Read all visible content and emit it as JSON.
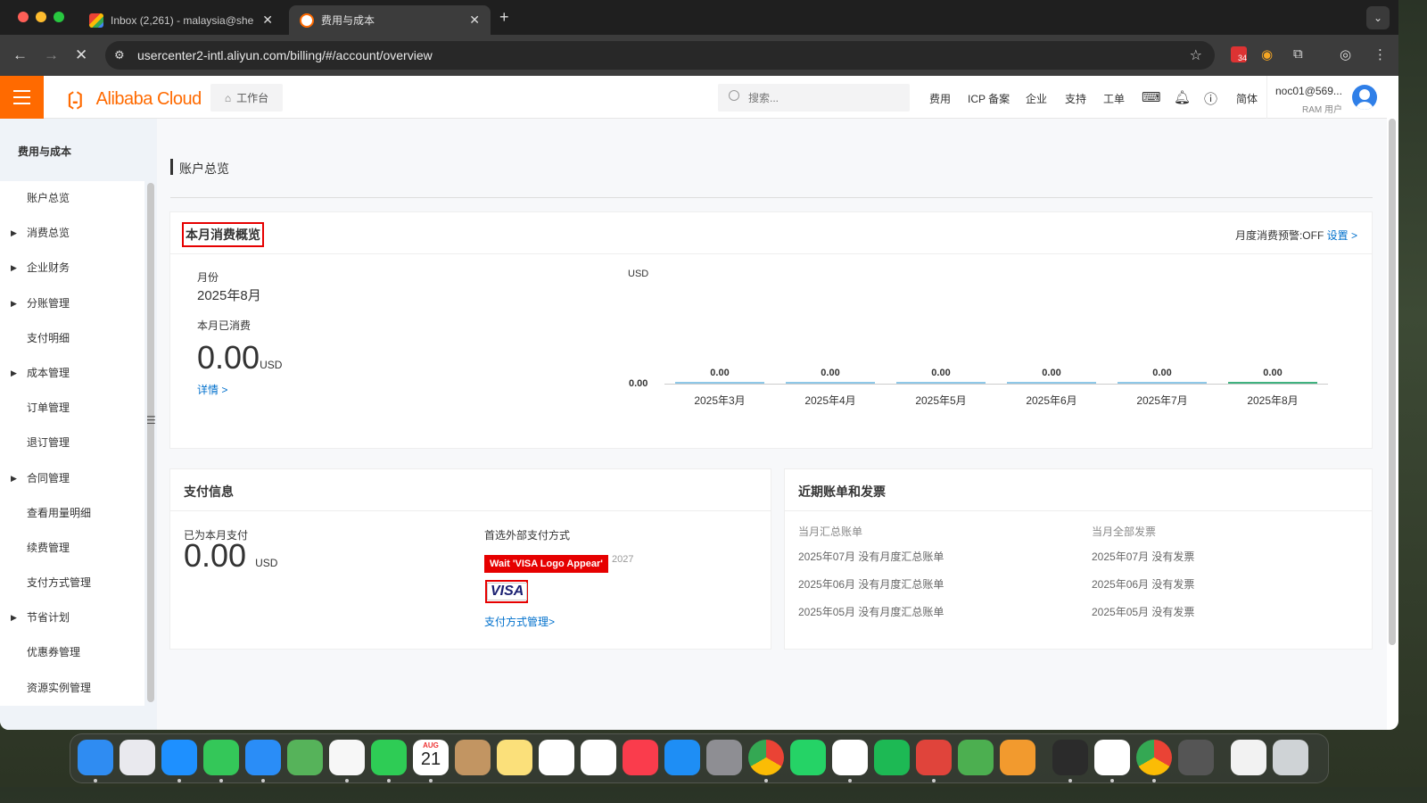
{
  "browser": {
    "tabs": [
      {
        "title": "Inbox (2,261) - malaysia@she",
        "favicon_color": "#ea4335"
      },
      {
        "title": "费用与成本",
        "favicon_color": "#ff6a00"
      }
    ],
    "url": "usercenter2-intl.aliyun.com/billing/#/account/overview",
    "calendar_badge": "34"
  },
  "header": {
    "logo_mark": "〔-〕",
    "logo_text": "Alibaba Cloud",
    "workbench": "工作台",
    "search_placeholder": "搜索...",
    "nav": [
      "费用",
      "ICP 备案",
      "企业",
      "支持",
      "工单"
    ],
    "lang": "简体",
    "user_name": "noc01@569...",
    "user_role": "RAM 用户"
  },
  "sidebar": {
    "title": "费用与成本",
    "items": [
      {
        "label": "账户总览",
        "expandable": false
      },
      {
        "label": "消费总览",
        "expandable": true
      },
      {
        "label": "企业财务",
        "expandable": true
      },
      {
        "label": "分账管理",
        "expandable": true
      },
      {
        "label": "支付明细",
        "expandable": false
      },
      {
        "label": "成本管理",
        "expandable": true
      },
      {
        "label": "订单管理",
        "expandable": false
      },
      {
        "label": "退订管理",
        "expandable": false
      },
      {
        "label": "合同管理",
        "expandable": true
      },
      {
        "label": "查看用量明细",
        "expandable": false
      },
      {
        "label": "续费管理",
        "expandable": false
      },
      {
        "label": "支付方式管理",
        "expandable": false
      },
      {
        "label": "节省计划",
        "expandable": true
      },
      {
        "label": "优惠券管理",
        "expandable": false
      },
      {
        "label": "资源实例管理",
        "expandable": false
      }
    ]
  },
  "page": {
    "title": "账户总览",
    "overview": {
      "title": "本月消费概览",
      "alert_label": "月度消费预警:OFF",
      "alert_link": "设置 >",
      "month_label": "月份",
      "month_value": "2025年8月",
      "spent_label": "本月已消费",
      "spent_amount": "0.00",
      "spent_unit": "USD",
      "details_link": "详情 >"
    },
    "payment": {
      "title": "支付信息",
      "paid_label": "已为本月支付",
      "paid_amount": "0.00",
      "paid_unit": "USD",
      "method_label": "首选外部支付方式",
      "warn_tag": "Wait 'VISA Logo Appear'",
      "ghost_date": "2027",
      "card_brand": "VISA",
      "manage_link": "支付方式管理>"
    },
    "bills": {
      "title": "近期账单和发票",
      "summary_header": "当月汇总账单",
      "invoice_header": "当月全部发票",
      "summary_rows": [
        "2025年07月 没有月度汇总账单",
        "2025年06月 没有月度汇总账单",
        "2025年05月 没有月度汇总账单"
      ],
      "invoice_rows": [
        "2025年07月 没有发票",
        "2025年06月 没有发票",
        "2025年05月 没有发票"
      ]
    }
  },
  "chart_data": {
    "type": "bar",
    "ylabel": "USD",
    "categories": [
      "2025年3月",
      "2025年4月",
      "2025年5月",
      "2025年6月",
      "2025年7月",
      "2025年8月"
    ],
    "values": [
      0.0,
      0.0,
      0.0,
      0.0,
      0.0,
      0.0
    ],
    "value_labels": [
      "0.00",
      "0.00",
      "0.00",
      "0.00",
      "0.00",
      "0.00"
    ],
    "y_tick": "0.00",
    "bar_color": "#8ec8e8",
    "highlight_color": "#3fb27f"
  },
  "dock": {
    "apps": [
      {
        "name": "finder",
        "color": "#2f8cf2"
      },
      {
        "name": "launchpad",
        "color": "#e9e9ee"
      },
      {
        "name": "safari",
        "color": "#1e90ff"
      },
      {
        "name": "messages",
        "color": "#34c759"
      },
      {
        "name": "mail",
        "color": "#2a8df7"
      },
      {
        "name": "maps",
        "color": "#56b35a"
      },
      {
        "name": "photos",
        "color": "#f7f7f7"
      },
      {
        "name": "facetime",
        "color": "#2ecc55"
      },
      {
        "name": "calendar",
        "color": "#ffffff"
      },
      {
        "name": "contacts",
        "color": "#c29562"
      },
      {
        "name": "notes",
        "color": "#fbe07a"
      },
      {
        "name": "reminders",
        "color": "#ffffff"
      },
      {
        "name": "freeform",
        "color": "#ffffff"
      },
      {
        "name": "music",
        "color": "#fa3c4c"
      },
      {
        "name": "app-store",
        "color": "#1e8ef5"
      },
      {
        "name": "system-settings",
        "color": "#8e8e93"
      },
      {
        "name": "chrome",
        "color": "#ffffff"
      },
      {
        "name": "whatsapp",
        "color": "#25d366"
      },
      {
        "name": "vscode",
        "color": "#ffffff"
      },
      {
        "name": "spotify",
        "color": "#1db954"
      },
      {
        "name": "free-t",
        "color": "#e0443b"
      },
      {
        "name": "free-p",
        "color": "#4caf50"
      },
      {
        "name": "free-s",
        "color": "#f29a2e"
      },
      {
        "name": "quicktime",
        "color": "#2b2b2b"
      },
      {
        "name": "chatgpt",
        "color": "#ffffff"
      },
      {
        "name": "chrome-2",
        "color": "#ffffff"
      },
      {
        "name": "rocket",
        "color": "#555555"
      },
      {
        "name": "document",
        "color": "#f2f2f2"
      },
      {
        "name": "trash",
        "color": "#cfd3d6"
      }
    ],
    "calendar_month": "AUG",
    "calendar_day": "21"
  }
}
